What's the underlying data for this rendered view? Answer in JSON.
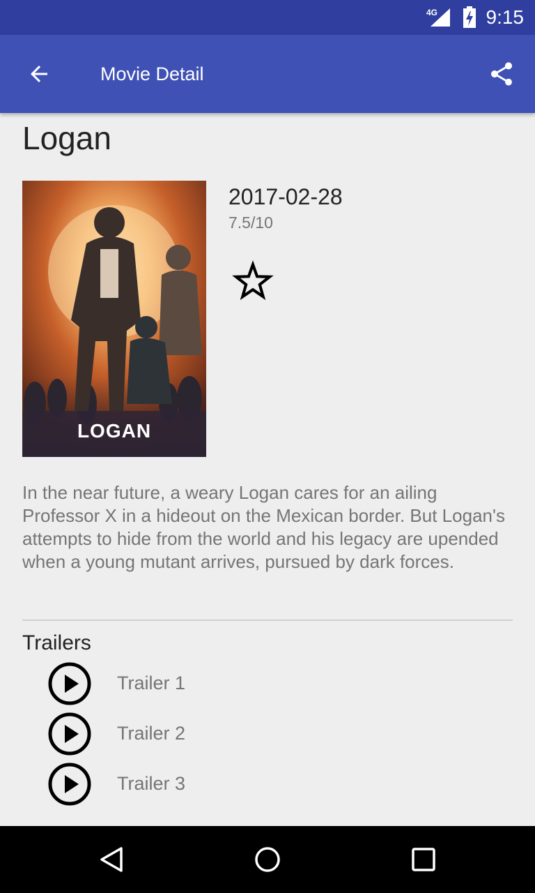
{
  "status_bar": {
    "time": "9:15",
    "network_label": "4G",
    "icons": [
      "signal-4g-icon",
      "battery-charging-icon"
    ]
  },
  "app_bar": {
    "title": "Movie Detail",
    "back_icon": "arrow-back-icon",
    "share_icon": "share-icon",
    "color": "#3f51b5",
    "status_color": "#303f9f"
  },
  "movie": {
    "title": "Logan",
    "poster_text": "LOGAN",
    "release_date": "2017-02-28",
    "rating": "7.5/10",
    "favorite_icon": "star-outline-icon",
    "overview": "In the near future, a weary Logan cares for an ailing Professor X in a hideout on the Mexican border. But Logan's attempts to hide from the world and his legacy are upended when a young mutant arrives, pursued by dark forces."
  },
  "trailers": {
    "heading": "Trailers",
    "items": [
      {
        "label": "Trailer 1",
        "icon": "play-circle-icon"
      },
      {
        "label": "Trailer 2",
        "icon": "play-circle-icon"
      },
      {
        "label": "Trailer 3",
        "icon": "play-circle-icon"
      }
    ]
  },
  "nav_bar": {
    "icons": [
      "back-triangle-icon",
      "home-circle-icon",
      "recents-square-icon"
    ]
  }
}
